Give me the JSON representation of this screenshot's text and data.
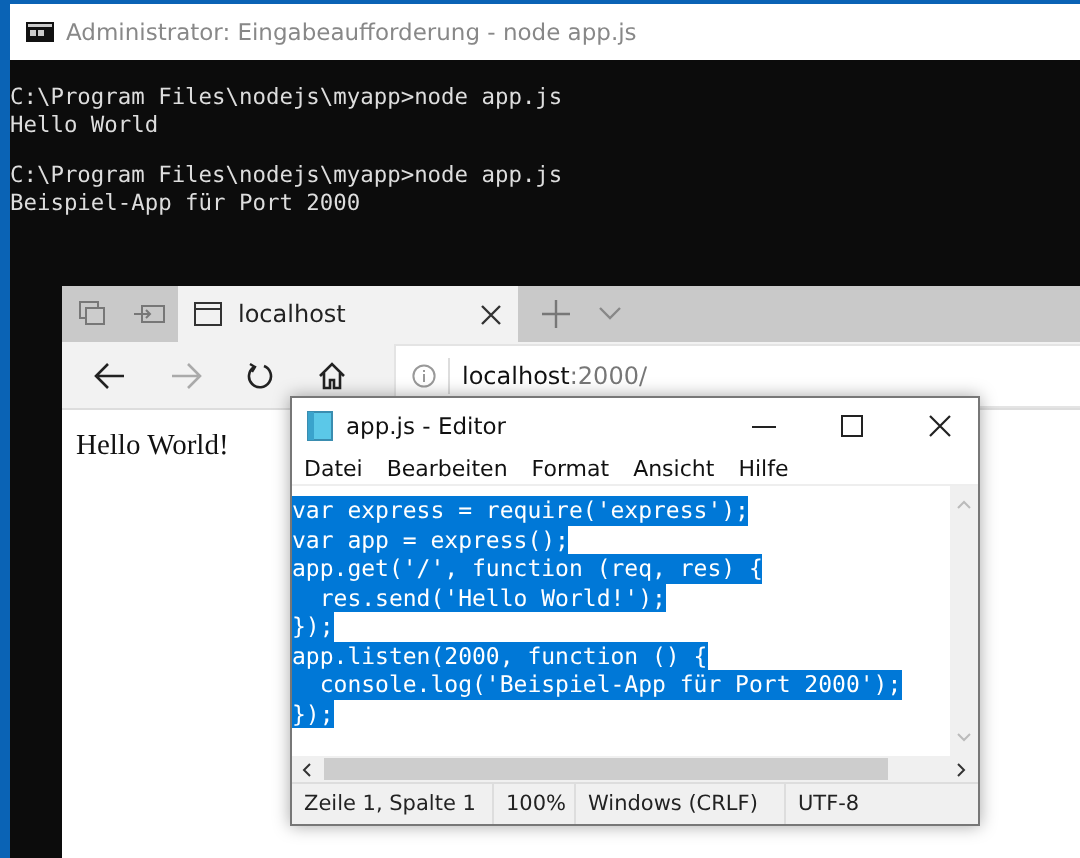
{
  "console": {
    "title": "Administrator: Eingabeaufforderung - node  app.js",
    "blocks": [
      {
        "lines": [
          "C:\\Program Files\\nodejs\\myapp>node app.js",
          "Hello World"
        ]
      },
      {
        "lines": [
          "C:\\Program Files\\nodejs\\myapp>node app.js",
          "Beispiel-App für Port 2000"
        ]
      }
    ]
  },
  "browser": {
    "tabs": [
      {
        "label": "localhost",
        "selected": true
      }
    ],
    "address": {
      "host": "localhost",
      "rest": ":2000/"
    },
    "page_text": "Hello World!"
  },
  "editor": {
    "title": "app.js - Editor",
    "menu": [
      "Datei",
      "Bearbeiten",
      "Format",
      "Ansicht",
      "Hilfe"
    ],
    "lines": [
      {
        "text": "var express = require('express');",
        "selected": true
      },
      {
        "text": "var app = express();",
        "selected": true
      },
      {
        "text": "app.get('/', function (req, res) {",
        "selected": true
      },
      {
        "text": "  res.send('Hello World!');",
        "selected": true
      },
      {
        "text": "});",
        "selected": true
      },
      {
        "text": "app.listen(2000, function () {",
        "selected": true
      },
      {
        "text": "  console.log('Beispiel-App für Port 2000');",
        "selected": true
      },
      {
        "text": "});",
        "selected": true
      }
    ],
    "status": [
      "Zeile 1, Spalte 1",
      "100%",
      "Windows (CRLF)",
      "UTF-8"
    ]
  }
}
